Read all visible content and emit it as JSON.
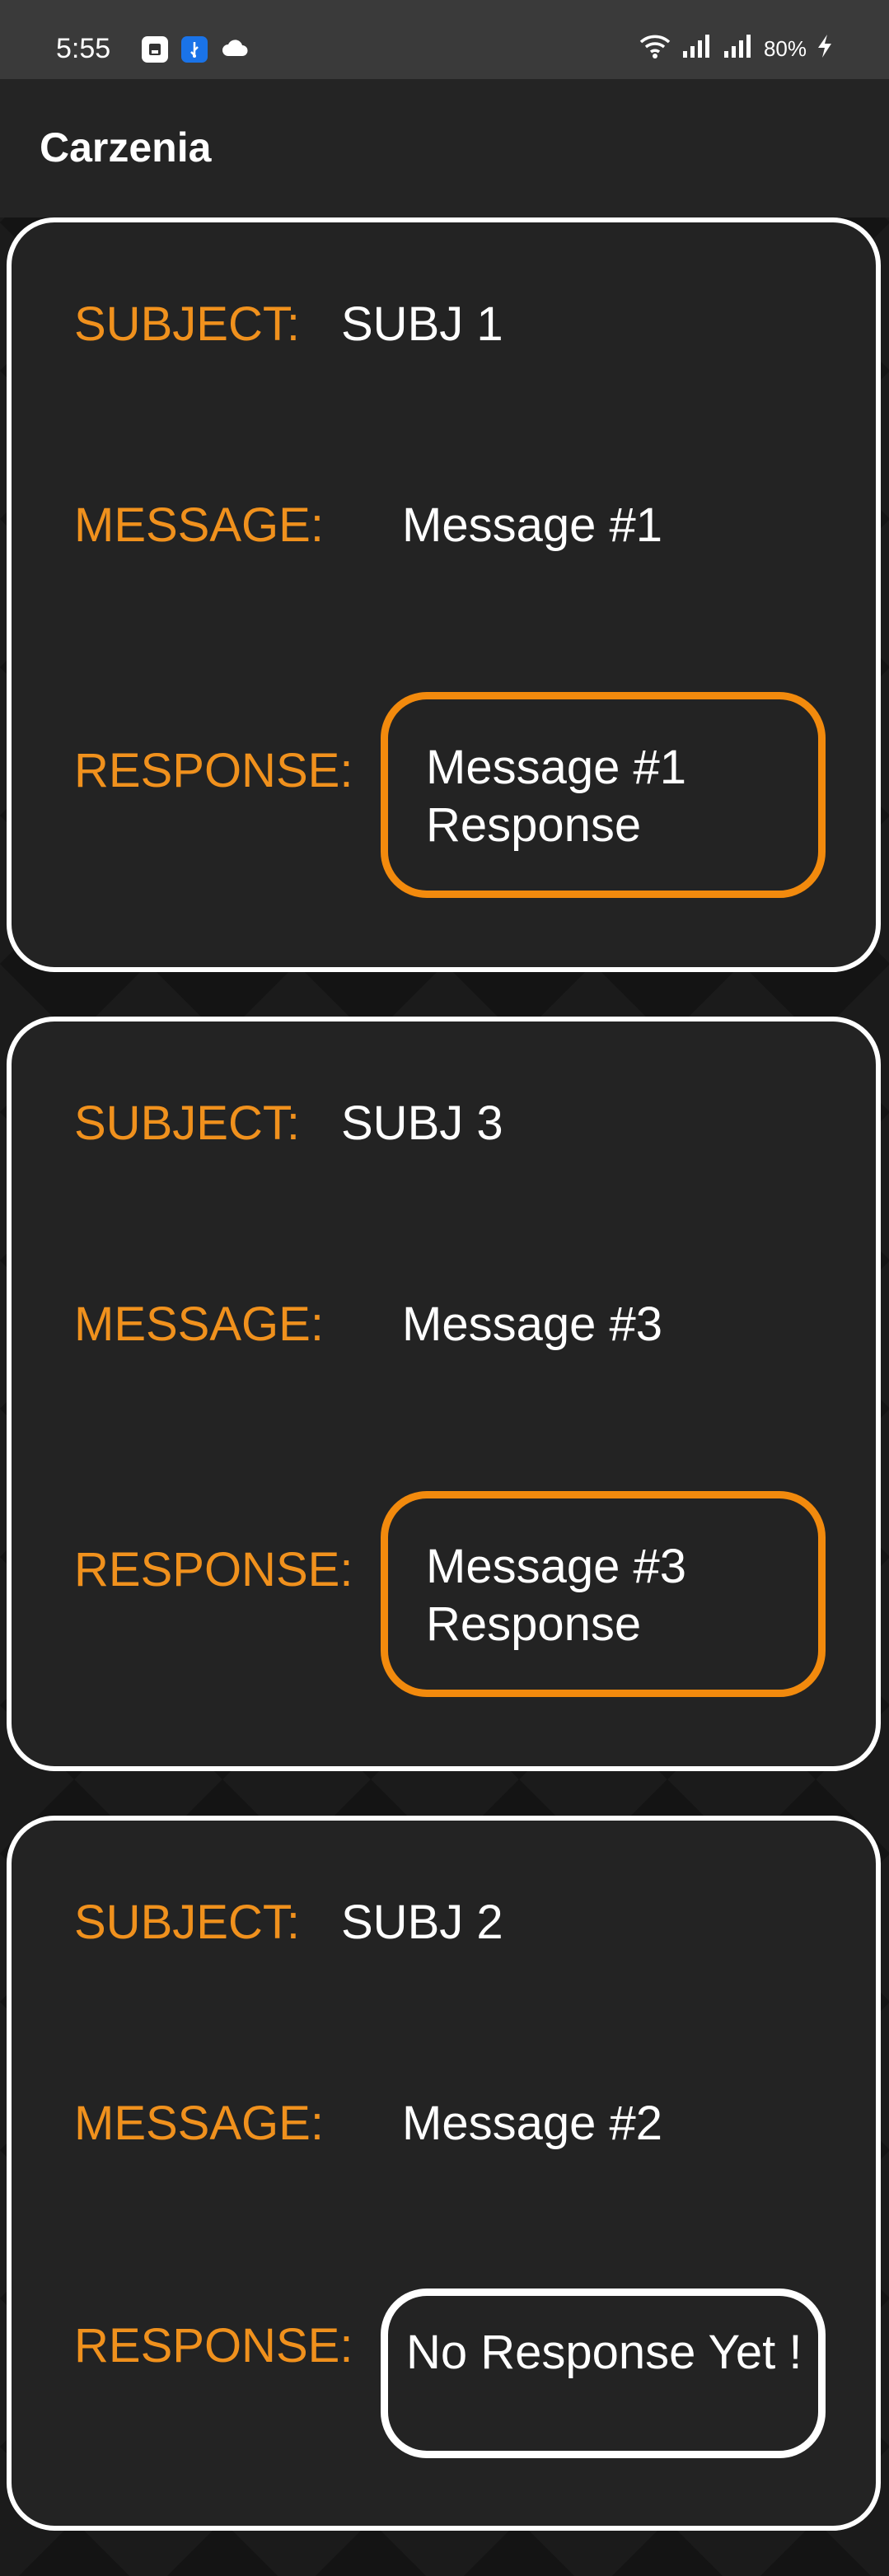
{
  "status_bar": {
    "time": "5:55",
    "battery": "80%",
    "icons": [
      "save-icon",
      "usb-icon",
      "cloud-icon",
      "wifi-icon",
      "signal-icon",
      "signal-icon",
      "charging-icon"
    ]
  },
  "app": {
    "title": "Carzenia"
  },
  "labels": {
    "subject": "SUBJECT:",
    "message": "MESSAGE:",
    "response": "RESPONSE:"
  },
  "cards": [
    {
      "subject": "SUBJ 1",
      "message": "Message #1",
      "response": "Message #1 Response"
    },
    {
      "subject": "SUBJ 3",
      "message": "Message #3",
      "response": "Message #3 Response"
    },
    {
      "subject": "SUBJ 2",
      "message": "Message #2",
      "response": "No Response Yet !"
    }
  ],
  "colors": {
    "accent": "#f28a0d",
    "label": "#f0911d",
    "card_bg": "#232323",
    "text": "#ffffff"
  }
}
